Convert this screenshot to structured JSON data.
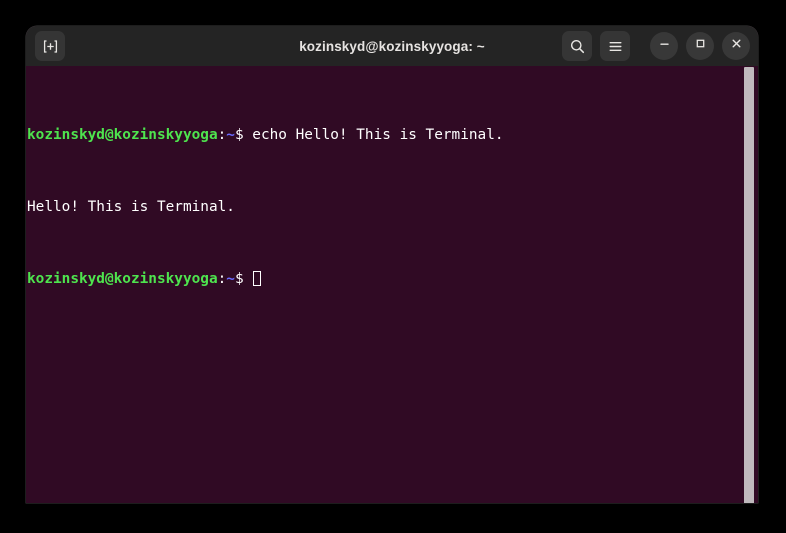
{
  "window": {
    "title": "kozinskyd@kozinskyyoga: ~",
    "background_color": "#300a24",
    "titlebar_color": "#242424"
  },
  "titlebar": {
    "new_tab_label": "New Tab",
    "search_label": "Search",
    "menu_label": "Main Menu",
    "minimize_label": "Minimize",
    "maximize_label": "Maximize",
    "close_label": "Close"
  },
  "terminal": {
    "user_host": "kozinskyd@kozinskyyoga",
    "separator": ":",
    "path": "~",
    "prompt_symbol": "$ ",
    "colors": {
      "prompt_green": "#4ee44e",
      "path_blue": "#6a6aff",
      "text_white": "#ffffff",
      "background": "#300a24"
    },
    "lines": [
      {
        "type": "command",
        "user_host": "kozinskyd@kozinskyyoga",
        "separator": ":",
        "path": "~",
        "prompt_symbol": "$ ",
        "command": "echo Hello! This is Terminal."
      },
      {
        "type": "output",
        "text": "Hello! This is Terminal."
      },
      {
        "type": "prompt",
        "user_host": "kozinskyd@kozinskyyoga",
        "separator": ":",
        "path": "~",
        "prompt_symbol": "$ ",
        "command": ""
      }
    ]
  },
  "scrollbar": {
    "position": "right",
    "thumb_color": "#bfb9bd"
  }
}
